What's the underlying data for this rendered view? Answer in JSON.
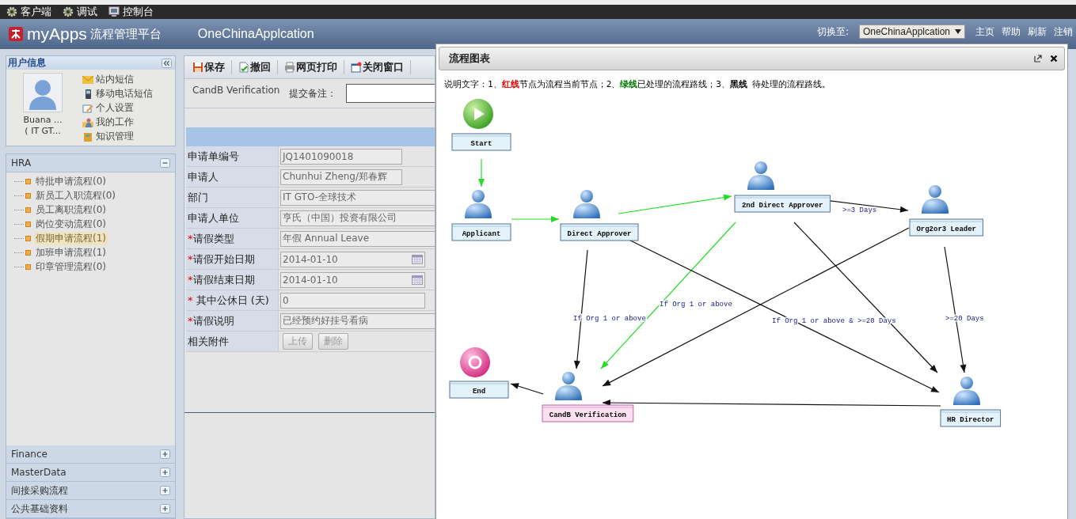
{
  "top_bar": {
    "items": [
      {
        "label": "客户端"
      },
      {
        "label": "调试"
      },
      {
        "label": "控制台"
      }
    ]
  },
  "header": {
    "brand": "myApps",
    "platform": "流程管理平台",
    "app_name": "OneChinaApplcation",
    "switch_label": "切换至:",
    "switch_value": "OneChinaApplcation",
    "links": [
      "主页",
      "帮助",
      "刷新",
      "注销"
    ]
  },
  "user_panel": {
    "title": "用户信息",
    "name": "Buana ...",
    "dept": "( IT GT...",
    "links": [
      "站内短信",
      "移动电话短信",
      "个人设置",
      "我的工作",
      "知识管理"
    ]
  },
  "nav_sections": [
    {
      "title": "HRA",
      "expanded": true,
      "items": [
        {
          "label": "特批申请流程(0)",
          "selected": false
        },
        {
          "label": "新员工入职流程(0)",
          "selected": false
        },
        {
          "label": "员工离职流程(0)",
          "selected": false
        },
        {
          "label": "岗位变动流程(0)",
          "selected": false
        },
        {
          "label": "假期申请流程(1)",
          "selected": true
        },
        {
          "label": "加班申请流程(1)",
          "selected": false
        },
        {
          "label": "印章管理流程(0)",
          "selected": false
        }
      ]
    },
    {
      "title": "Finance",
      "expanded": false
    },
    {
      "title": "MasterData",
      "expanded": false
    },
    {
      "title": "间接采购流程",
      "expanded": false
    },
    {
      "title": "公共基础资料",
      "expanded": false
    }
  ],
  "toolbar": [
    "保存",
    "撤回",
    "网页打印",
    "关闭窗口"
  ],
  "form": {
    "step": "CandB Verification",
    "remark_label": "提交备注：",
    "fields": [
      {
        "label": "申请单编号",
        "kind": "short",
        "value": "JQ1401090018"
      },
      {
        "label": "申请人",
        "kind": "short",
        "value": "Chunhui Zheng/郑春辉"
      },
      {
        "label": "部门",
        "kind": "text",
        "value": "IT GTO-全球技术"
      },
      {
        "label": "申请人单位",
        "kind": "text",
        "value": "亨氏（中国）投资有限公司"
      },
      {
        "label": "请假类型",
        "required_mark": "*",
        "kind": "text",
        "value": "年假 Annual Leave"
      },
      {
        "label": "请假开始日期",
        "required_mark": "*",
        "kind": "date",
        "value": "2014-01-10"
      },
      {
        "label": "请假结束日期",
        "required_mark": "*",
        "kind": "date",
        "value": "2014-01-10"
      },
      {
        "label": "其中公休日 (天)",
        "required_mark": "* ",
        "kind": "number",
        "value": "0"
      },
      {
        "label": "请假说明",
        "required_mark": "*",
        "kind": "text",
        "value": "已经预约好挂号看病"
      },
      {
        "label": "相关附件",
        "kind": "buttons",
        "buttons": [
          {
            "label": "上传",
            "disabled": true
          },
          {
            "label": "删除",
            "disabled": true
          }
        ]
      }
    ]
  },
  "dialog": {
    "title": "流程图表",
    "legend": [
      {
        "text": "说明文字：1、"
      },
      {
        "text": "红线",
        "color": "#e00000"
      },
      {
        "text": "节点为流程当前节点；2、"
      },
      {
        "text": "绿线",
        "color": "#007a00"
      },
      {
        "text": "已处理的流程路线；3、"
      },
      {
        "text": "黑线",
        "color": "#000000"
      },
      {
        "text": " 待处理的流程路线。"
      }
    ],
    "nodes": [
      {
        "label": "Start",
        "kind": "start",
        "current": false
      },
      {
        "label": "Applicant",
        "kind": "user",
        "current": false
      },
      {
        "label": "Direct Approver",
        "kind": "user",
        "current": false
      },
      {
        "label": "2nd Direct Approver",
        "kind": "user",
        "current": false
      },
      {
        "label": "Org2or3 Leader",
        "kind": "user",
        "current": false
      },
      {
        "label": "End",
        "kind": "end",
        "current": false
      },
      {
        "label": "CandB Verification",
        "kind": "user",
        "current": true
      },
      {
        "label": "HR Director",
        "kind": "user",
        "current": false
      }
    ],
    "edges": [
      {
        "processed": true
      },
      {
        "processed": true
      },
      {
        "processed": true
      },
      {
        "processed": false,
        "label": ">=3 Days"
      },
      {
        "processed": false,
        "label": "If Org 1 or above"
      },
      {
        "processed": true,
        "label": "If Org 1 or above"
      },
      {
        "processed": false,
        "label": "If Org 1 or above & >=20 Days"
      },
      {
        "processed": false
      },
      {
        "processed": false
      },
      {
        "processed": false,
        "label": ">=20 Days"
      },
      {
        "processed": false
      },
      {
        "processed": false
      }
    ]
  }
}
